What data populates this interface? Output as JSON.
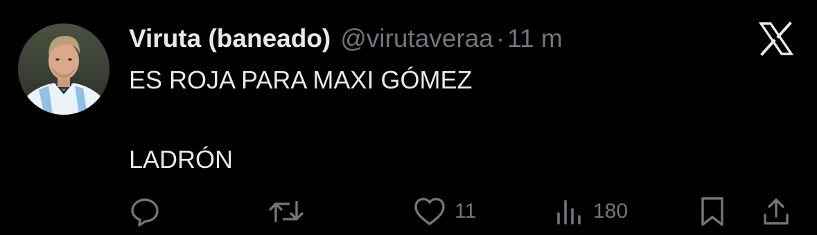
{
  "author": {
    "display_name": "Viruta (baneado)",
    "handle": "@virutaveraa",
    "separator": "·",
    "time": "11 m"
  },
  "tweet": {
    "lines": [
      "ES ROJA PARA MAXI GÓMEZ",
      "LADRÓN"
    ]
  },
  "metrics": {
    "replies": "",
    "retweets": "",
    "likes": "11",
    "views": "180"
  },
  "icons": {
    "logo": "x-logo-icon",
    "reply": "reply-icon",
    "retweet": "retweet-icon",
    "like": "heart-icon",
    "views": "views-icon",
    "bookmark": "bookmark-icon",
    "share": "share-icon"
  },
  "colors": {
    "background": "#000000",
    "primary_text": "#e7e9ea",
    "secondary_text": "#71767b"
  }
}
